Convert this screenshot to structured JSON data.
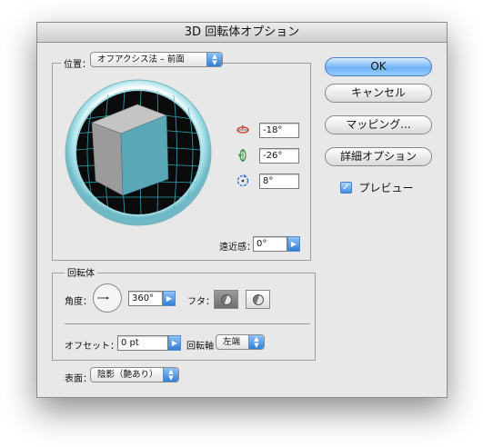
{
  "window": {
    "title": "3D 回転体オプション"
  },
  "position": {
    "label": "位置：",
    "preset": "オフアクシス法 – 前面",
    "rotation_x": "-18°",
    "rotation_y": "-26°",
    "rotation_z": "8°",
    "perspective_label": "遠近感：",
    "perspective_value": "0°"
  },
  "revolve": {
    "group_label": "回転体",
    "angle_label": "角度：",
    "angle_value": "360°",
    "cap_label": "フタ：",
    "offset_label": "オフセット：",
    "offset_value": "0 pt",
    "axis_label": "回転軸",
    "axis_value": "左端"
  },
  "surface": {
    "label": "表面：",
    "value": "陰影（艶あり）"
  },
  "buttons": {
    "ok": "OK",
    "cancel": "キャンセル",
    "map_art": "マッピング...",
    "more_options": "詳細オプション"
  },
  "preview": {
    "label": "プレビュー",
    "checked": true
  },
  "colors": {
    "accent": "#3f8fe3",
    "cube_front": "#5aa7b8",
    "cube_side": "#9b9b9b",
    "cube_top": "#c4c4c4",
    "track_grid": "#2fb7c7"
  },
  "icons": [
    "rotate-x-icon",
    "rotate-y-icon",
    "rotate-z-icon",
    "angle-dial-icon",
    "cap-on-icon",
    "cap-off-icon",
    "checkbox-icon"
  ]
}
